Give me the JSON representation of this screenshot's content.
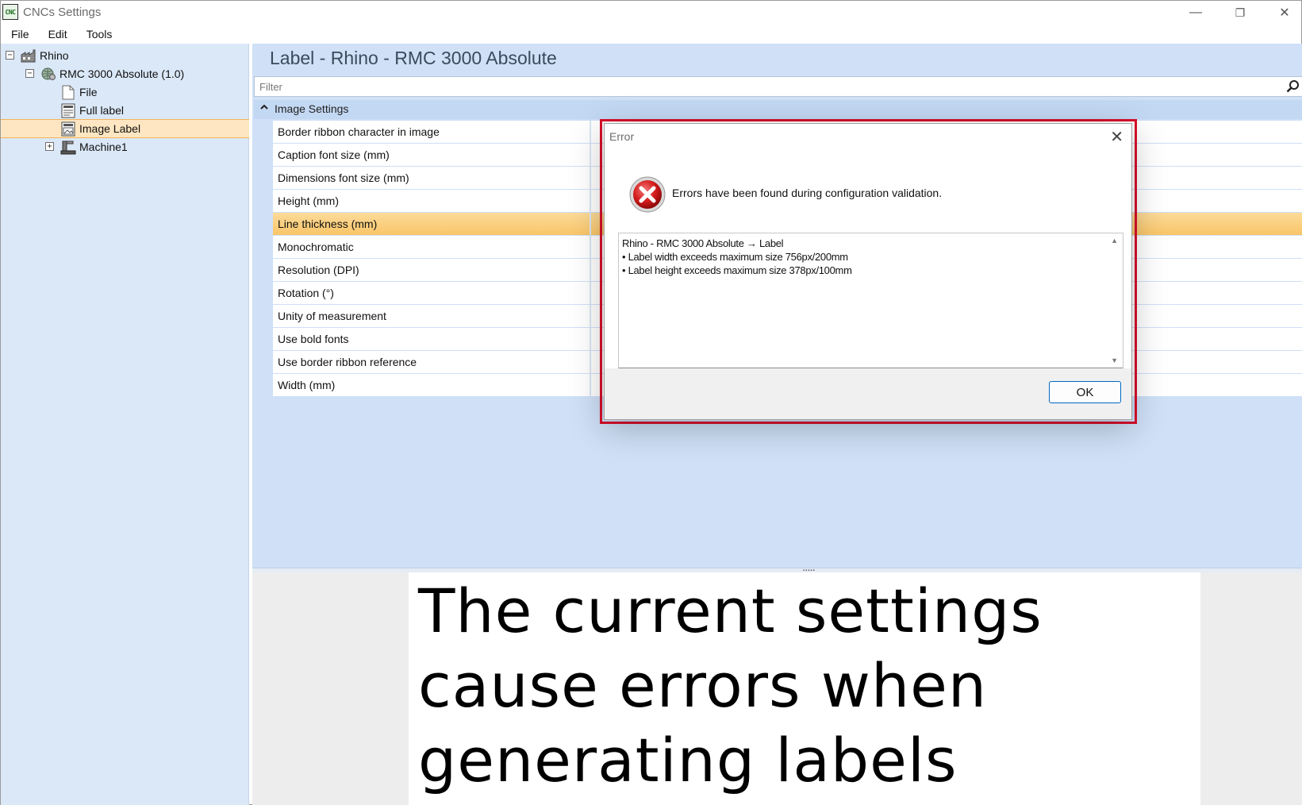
{
  "window": {
    "app_icon_text": "CNC",
    "title": "CNCs Settings",
    "minimize": "—",
    "restore": "❐",
    "close": "✕"
  },
  "menu": [
    "File",
    "Edit",
    "Tools"
  ],
  "tree": {
    "items": [
      {
        "label": "Rhino",
        "expander": "−",
        "icon": "factory-icon"
      },
      {
        "label": "RMC 3000 Absolute (1.0)",
        "expander": "−",
        "icon": "globe-gear-icon"
      },
      {
        "label": "File",
        "icon": "file-icon"
      },
      {
        "label": "Full label",
        "icon": "label-icon"
      },
      {
        "label": "Image Label",
        "icon": "image-label-icon",
        "selected": true
      },
      {
        "label": "Machine1",
        "expander": "+",
        "icon": "machine-icon"
      }
    ]
  },
  "content": {
    "title": "Label - Rhino - RMC 3000 Absolute",
    "filter_placeholder": "Filter",
    "category": "Image Settings",
    "properties": [
      "Border ribbon character in image",
      "Caption font size (mm)",
      "Dimensions font size (mm)",
      "Height (mm)",
      "Line thickness (mm)",
      "Monochromatic",
      "Resolution (DPI)",
      "Rotation (°)",
      "Unity of measurement",
      "Use bold fonts",
      "Use border ribbon reference",
      "Width (mm)"
    ],
    "selected_property": "Line thickness (mm)"
  },
  "preview": {
    "line1": "The current settings",
    "line2": "cause errors when",
    "line3": "generating labels"
  },
  "dialog": {
    "title": "Error",
    "close": "✕",
    "message": "Errors have been found during configuration validation.",
    "details": [
      "Rhino - RMC 3000 Absolute → Label",
      "• Label width exceeds maximum size 756px/200mm",
      "• Label height exceeds maximum size 378px/100mm"
    ],
    "ok_label": "OK"
  },
  "colors": {
    "accent_blue": "#0067c0",
    "error_red": "#d8102a",
    "selection_orange": "#f9c568",
    "panel_blue": "#cfe0f7"
  }
}
